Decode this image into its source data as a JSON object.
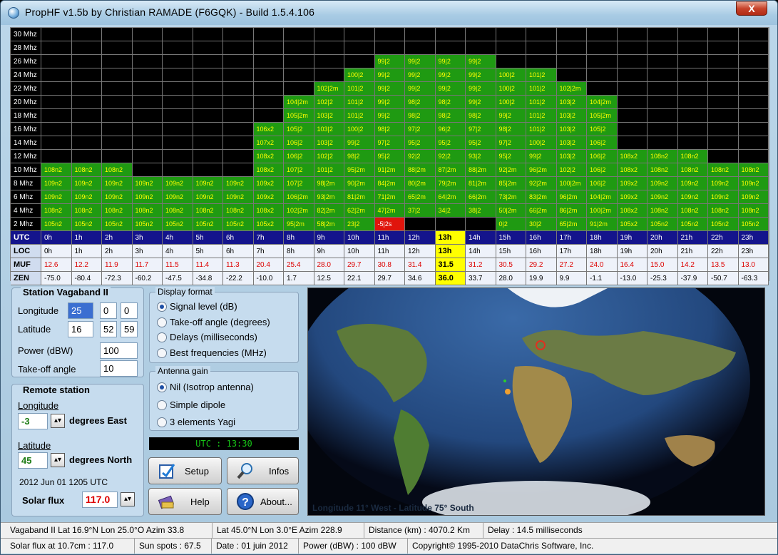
{
  "window": {
    "title": "PropHF v1.5b by Christian RAMADE (F6GQK) - Build 1.5.4.106",
    "close_label": "X"
  },
  "grid": {
    "freq_rows": [
      {
        "label": "30 Mhz",
        "cells": [
          "",
          "",
          "",
          "",
          "",
          "",
          "",
          "",
          "",
          "",
          "",
          "",
          "",
          "",
          "",
          "",
          "",
          "",
          "",
          "",
          "",
          "",
          "",
          ""
        ]
      },
      {
        "label": "28 Mhz",
        "cells": [
          "",
          "",
          "",
          "",
          "",
          "",
          "",
          "",
          "",
          "",
          "",
          "",
          "",
          "",
          "",
          "",
          "",
          "",
          "",
          "",
          "",
          "",
          "",
          ""
        ]
      },
      {
        "label": "26 Mhz",
        "cells": [
          "",
          "",
          "",
          "",
          "",
          "",
          "",
          "",
          "",
          "",
          "",
          "99|2",
          "99|2",
          "99|2",
          "99|2",
          "",
          "",
          "",
          "",
          "",
          "",
          "",
          "",
          ""
        ]
      },
      {
        "label": "24 Mhz",
        "cells": [
          "",
          "",
          "",
          "",
          "",
          "",
          "",
          "",
          "",
          "",
          "100|2",
          "99|2",
          "99|2",
          "99|2",
          "99|2",
          "100|2",
          "101|2",
          "",
          "",
          "",
          "",
          "",
          "",
          ""
        ]
      },
      {
        "label": "22 Mhz",
        "cells": [
          "",
          "",
          "",
          "",
          "",
          "",
          "",
          "",
          "",
          "102|2m",
          "101|2",
          "99|2",
          "99|2",
          "99|2",
          "99|2",
          "100|2",
          "101|2",
          "102|2m",
          "",
          "",
          "",
          "",
          "",
          ""
        ]
      },
      {
        "label": "20 Mhz",
        "cells": [
          "",
          "",
          "",
          "",
          "",
          "",
          "",
          "",
          "104|2m",
          "102|2",
          "101|2",
          "99|2",
          "98|2",
          "98|2",
          "99|2",
          "100|2",
          "101|2",
          "103|2",
          "104|2m",
          "",
          "",
          "",
          "",
          ""
        ]
      },
      {
        "label": "18 Mhz",
        "cells": [
          "",
          "",
          "",
          "",
          "",
          "",
          "",
          "",
          "105|2m",
          "103|2",
          "101|2",
          "99|2",
          "98|2",
          "98|2",
          "98|2",
          "99|2",
          "101|2",
          "103|2",
          "105|2m",
          "",
          "",
          "",
          "",
          ""
        ]
      },
      {
        "label": "16 Mhz",
        "cells": [
          "",
          "",
          "",
          "",
          "",
          "",
          "",
          "106x2",
          "105|2",
          "103|2",
          "100|2",
          "98|2",
          "97|2",
          "96|2",
          "97|2",
          "98|2",
          "101|2",
          "103|2",
          "105|2",
          "",
          "",
          "",
          "",
          ""
        ]
      },
      {
        "label": "14 Mhz",
        "cells": [
          "",
          "",
          "",
          "",
          "",
          "",
          "",
          "107x2",
          "106|2",
          "103|2",
          "99|2",
          "97|2",
          "95|2",
          "95|2",
          "95|2",
          "97|2",
          "100|2",
          "103|2",
          "106|2",
          "",
          "",
          "",
          "",
          ""
        ]
      },
      {
        "label": "12 Mhz",
        "cells": [
          "",
          "",
          "",
          "",
          "",
          "",
          "",
          "108x2",
          "106|2",
          "102|2",
          "98|2",
          "95|2",
          "92|2",
          "92|2",
          "93|2",
          "95|2",
          "99|2",
          "103|2",
          "106|2",
          "108x2",
          "108n2",
          "108n2",
          "",
          ""
        ]
      },
      {
        "label": "10 Mhz",
        "cells": [
          "108n2",
          "108n2",
          "108n2",
          "",
          "",
          "",
          "",
          "108x2",
          "107|2",
          "101|2",
          "95|2m",
          "91|2m",
          "88|2m",
          "87|2m",
          "88|2m",
          "92|2m",
          "96|2m",
          "102|2",
          "106|2",
          "108x2",
          "108n2",
          "108n2",
          "108n2",
          "108n2"
        ]
      },
      {
        "label": "8 Mhz",
        "cells": [
          "109n2",
          "109n2",
          "109n2",
          "109n2",
          "109n2",
          "109n2",
          "109n2",
          "109x2",
          "107|2",
          "98|2m",
          "90|2m",
          "84|2m",
          "80|2m",
          "79|2m",
          "81|2m",
          "85|2m",
          "92|2m",
          "100|2m",
          "106|2",
          "109x2",
          "109n2",
          "109n2",
          "109n2",
          "109n2"
        ]
      },
      {
        "label": "6 Mhz",
        "cells": [
          "109n2",
          "109n2",
          "109n2",
          "109n2",
          "109n2",
          "109n2",
          "109n2",
          "109x2",
          "106|2m",
          "93|2m",
          "81|2m",
          "71|2m",
          "65|2m",
          "64|2m",
          "66|2m",
          "73|2m",
          "83|2m",
          "96|2m",
          "104|2m",
          "109x2",
          "109n2",
          "109n2",
          "109n2",
          "109n2"
        ]
      },
      {
        "label": "4 Mhz",
        "cells": [
          "108n2",
          "108n2",
          "108n2",
          "108n2",
          "108n2",
          "108n2",
          "108n2",
          "108x2",
          "102|2m",
          "82|2m",
          "62|2m",
          "47|2m",
          "37|2",
          "34|2",
          "38|2",
          "50|2m",
          "66|2m",
          "86|2m",
          "100|2m",
          "108x2",
          "108n2",
          "108n2",
          "108n2",
          "108n2"
        ]
      },
      {
        "label": "2 Mhz",
        "cells": [
          "105n2",
          "105n2",
          "105n2",
          "105n2",
          "105n2",
          "105n2",
          "105n2",
          "105x2",
          "95|2m",
          "58|2m",
          "23|2",
          "-5|2s",
          "",
          "",
          "",
          "0|2",
          "30|2",
          "65|2m",
          "91|2m",
          "105x2",
          "105n2",
          "105n2",
          "105n2",
          "105n2"
        ]
      }
    ],
    "utc": {
      "label": "UTC",
      "cells": [
        "0h",
        "1h",
        "2h",
        "3h",
        "4h",
        "5h",
        "6h",
        "7h",
        "8h",
        "9h",
        "10h",
        "11h",
        "12h",
        "13h",
        "14h",
        "15h",
        "16h",
        "17h",
        "18h",
        "19h",
        "20h",
        "21h",
        "22h",
        "23h"
      ]
    },
    "loc": {
      "label": "LOC",
      "cells": [
        "0h",
        "1h",
        "2h",
        "3h",
        "4h",
        "5h",
        "6h",
        "7h",
        "8h",
        "9h",
        "10h",
        "11h",
        "12h",
        "13h",
        "14h",
        "15h",
        "16h",
        "17h",
        "18h",
        "19h",
        "20h",
        "21h",
        "22h",
        "23h"
      ]
    },
    "muf": {
      "label": "MUF",
      "cells": [
        "12.6",
        "12.2",
        "11.9",
        "11.7",
        "11.5",
        "11.4",
        "11.3",
        "20.4",
        "25.4",
        "28.0",
        "29.7",
        "30.8",
        "31.4",
        "31.5",
        "31.2",
        "30.5",
        "29.2",
        "27.2",
        "24.0",
        "16.4",
        "15.0",
        "14.2",
        "13.5",
        "13.0"
      ]
    },
    "zen": {
      "label": "ZEN",
      "cells": [
        "-75.0",
        "-80.4",
        "-72.3",
        "-60.2",
        "-47.5",
        "-34.8",
        "-22.2",
        "-10.0",
        "1.7",
        "12.5",
        "22.1",
        "29.7",
        "34.6",
        "36.0",
        "33.7",
        "28.0",
        "19.9",
        "9.9",
        "-1.1",
        "-13.0",
        "-25.3",
        "-37.9",
        "-50.7",
        "-63.3"
      ]
    },
    "highlight_hour_index": 13
  },
  "station": {
    "title": "Station Vagaband II",
    "longitude_label": "Longitude",
    "longitude": [
      "25",
      "0",
      "0"
    ],
    "latitude_label": "Latitude",
    "latitude": [
      "16",
      "52",
      "59"
    ],
    "power_label": "Power (dBW)",
    "power": "100",
    "takeoff_label": "Take-off angle",
    "takeoff": "10"
  },
  "remote": {
    "title": "Remote station",
    "longitude_label": "Longitude",
    "longitude": "-3",
    "longitude_unit": "degrees East",
    "latitude_label": "Latitude",
    "latitude": "45",
    "latitude_unit": "degrees North",
    "date": "2012 Jun 01 1205 UTC",
    "solar_label": "Solar flux",
    "solar": "117.0"
  },
  "display_format": {
    "title": "Display format",
    "options": [
      "Signal level (dB)",
      "Take-off angle (degrees)",
      "Delays (milliseconds)",
      "Best frequencies (MHz)"
    ],
    "selected": 0
  },
  "antenna": {
    "title": "Antenna gain",
    "options": [
      "Nil (Isotrop antenna)",
      "Simple dipole",
      "3 elements Yagi"
    ],
    "selected": 0
  },
  "clock": "UTC : 13:30",
  "buttons": {
    "setup": "Setup",
    "infos": "Infos",
    "help": "Help",
    "about": "About..."
  },
  "map": {
    "caption": "Longitude 11° West - Latitude 75° South"
  },
  "status1": [
    "Vagaband II Lat 16.9°N Lon 25.0°O Azim 33.8",
    "Lat 45.0°N Lon 3.0°E Azim 228.9",
    "Distance (km) : 4070.2 Km",
    "Delay : 14.5 milliseconds"
  ],
  "status2": [
    "Solar flux at 10.7cm : 117.0",
    "Sun spots : 67.5",
    "Date : 01 juin 2012",
    "Power (dBW) : 100 dBW",
    "Copyright© 1995-2010 DataChris Software, Inc."
  ]
}
